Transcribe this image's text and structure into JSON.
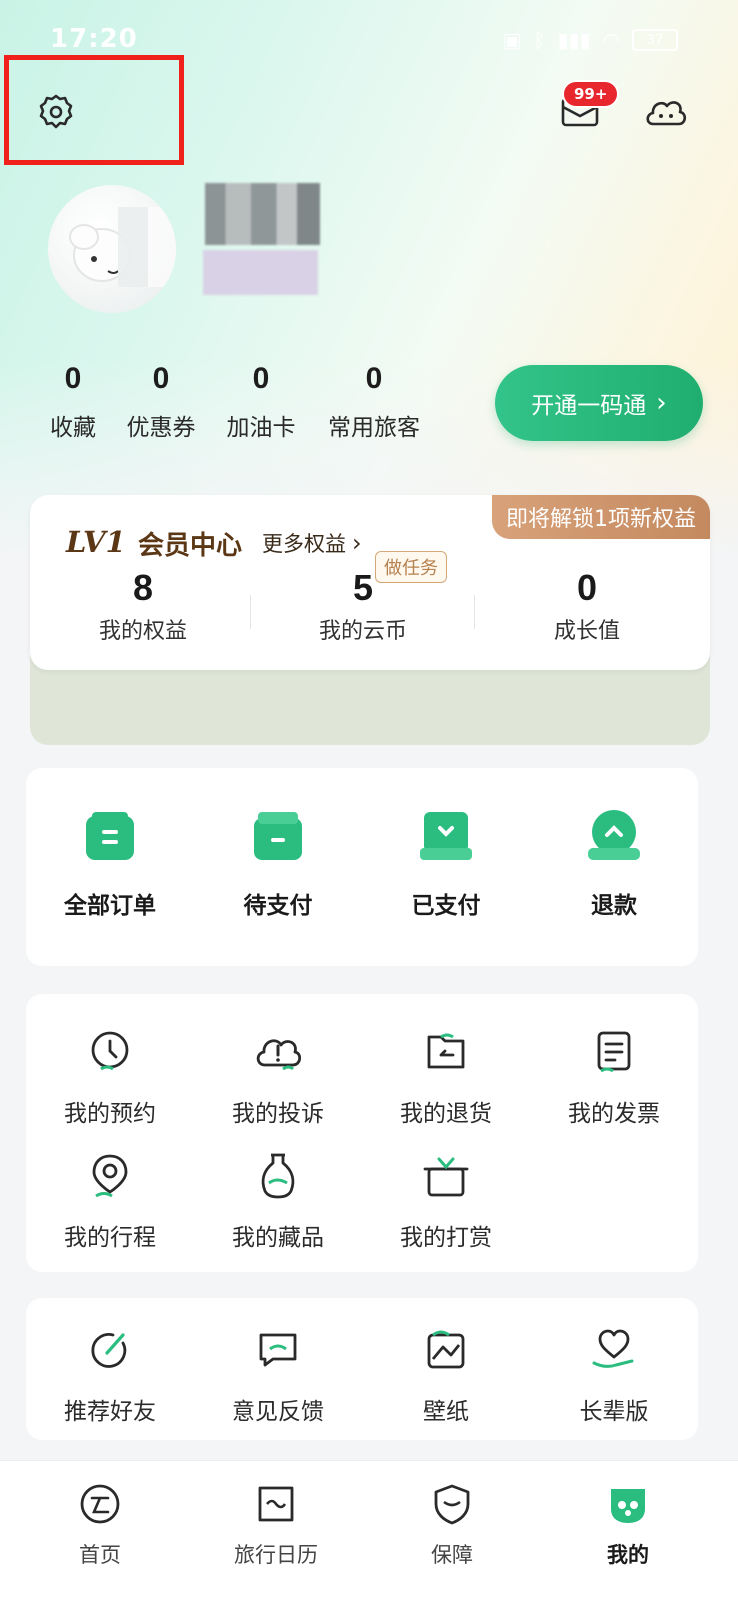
{
  "status_bar": {
    "time": "17:20",
    "battery": "37"
  },
  "header": {
    "message_badge": "99+"
  },
  "profile": {
    "stats": [
      {
        "value": "0",
        "label": "收藏"
      },
      {
        "value": "0",
        "label": "优惠券"
      },
      {
        "value": "0",
        "label": "加油卡"
      },
      {
        "value": "0",
        "label": "常用旅客"
      }
    ],
    "cta_label": "开通一码通"
  },
  "member": {
    "level": "LV1",
    "title": "会员中心",
    "more_label": "更多权益",
    "unlock_tag": "即将解锁1项新权益",
    "task_tag": "做任务",
    "stats": [
      {
        "value": "8",
        "label": "我的权益"
      },
      {
        "value": "5",
        "label": "我的云币"
      },
      {
        "value": "0",
        "label": "成长值"
      }
    ]
  },
  "orders": [
    {
      "label": "全部订单",
      "icon": "orders-all-icon"
    },
    {
      "label": "待支付",
      "icon": "pending-payment-icon"
    },
    {
      "label": "已支付",
      "icon": "paid-icon"
    },
    {
      "label": "退款",
      "icon": "refund-icon"
    }
  ],
  "tools": [
    {
      "label": "我的预约",
      "icon": "clock-icon"
    },
    {
      "label": "我的投诉",
      "icon": "cloud-alert-icon"
    },
    {
      "label": "我的退货",
      "icon": "return-icon"
    },
    {
      "label": "我的发票",
      "icon": "invoice-icon"
    },
    {
      "label": "我的行程",
      "icon": "location-pin-icon"
    },
    {
      "label": "我的藏品",
      "icon": "vase-icon"
    },
    {
      "label": "我的打赏",
      "icon": "gift-box-icon"
    }
  ],
  "more": [
    {
      "label": "推荐好友",
      "icon": "share-icon"
    },
    {
      "label": "意见反馈",
      "icon": "feedback-icon"
    },
    {
      "label": "壁纸",
      "icon": "wallpaper-icon"
    },
    {
      "label": "长辈版",
      "icon": "elder-mode-icon"
    }
  ],
  "bottom_nav": [
    {
      "label": "首页",
      "icon": "home-icon"
    },
    {
      "label": "旅行日历",
      "icon": "calendar-icon"
    },
    {
      "label": "保障",
      "icon": "shield-icon"
    },
    {
      "label": "我的",
      "icon": "profile-icon",
      "active": true
    }
  ],
  "colors": {
    "accent": "#1fae6f",
    "badge": "#e8262d",
    "member_brown": "#5b3716"
  }
}
